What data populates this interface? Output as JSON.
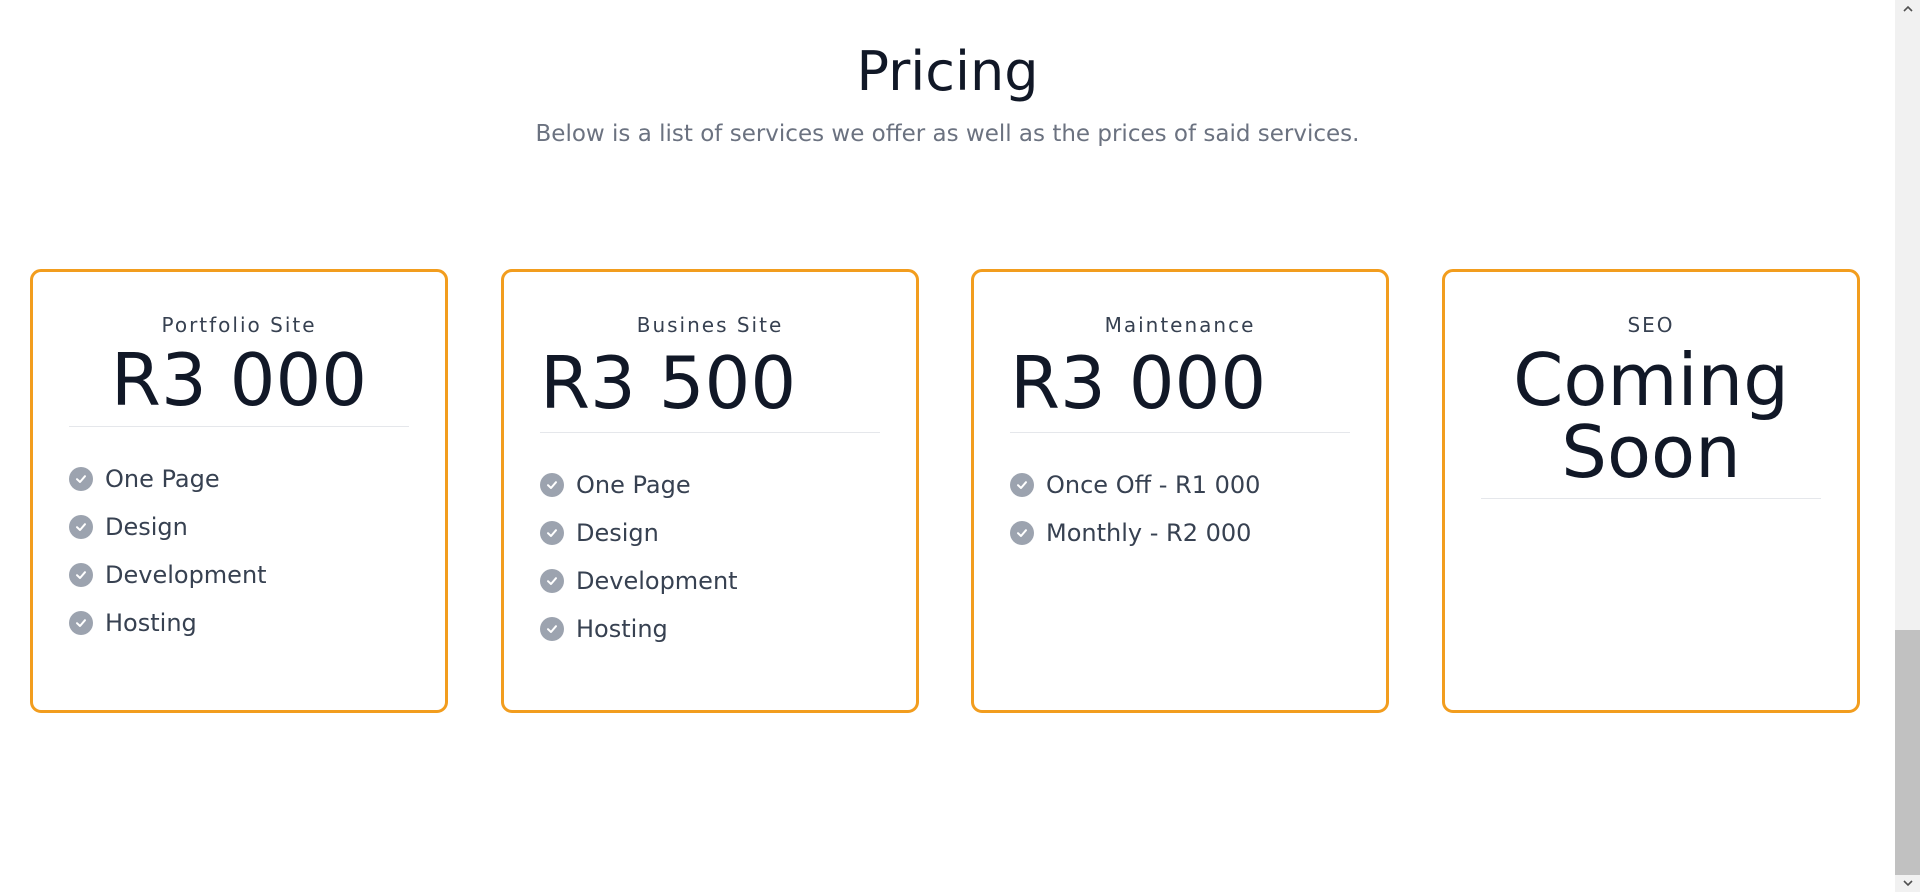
{
  "header": {
    "title": "Pricing",
    "subtitle": "Below is a list of services we offer as well as the prices of said services."
  },
  "cards": [
    {
      "name": "Portfolio Site",
      "price": "R3 000",
      "features": [
        "One Page",
        "Design",
        "Development",
        "Hosting"
      ]
    },
    {
      "name": "Busines Site",
      "price": "R3 500",
      "features": [
        "One Page",
        "Design",
        "Development",
        "Hosting"
      ]
    },
    {
      "name": "Maintenance",
      "price": "R3 000",
      "features": [
        "Once Off - R1 000",
        "Monthly - R2 000"
      ]
    },
    {
      "name": "SEO",
      "price": "Coming Soon",
      "features": []
    }
  ],
  "colors": {
    "accent_border": "#f29d1e",
    "check_icon": "#9ca3af",
    "subtitle_text": "#6b7280"
  },
  "icons": {
    "feature": "check-circle-icon",
    "scroll_up": "chevron-up-icon",
    "scroll_down": "chevron-down-icon"
  }
}
